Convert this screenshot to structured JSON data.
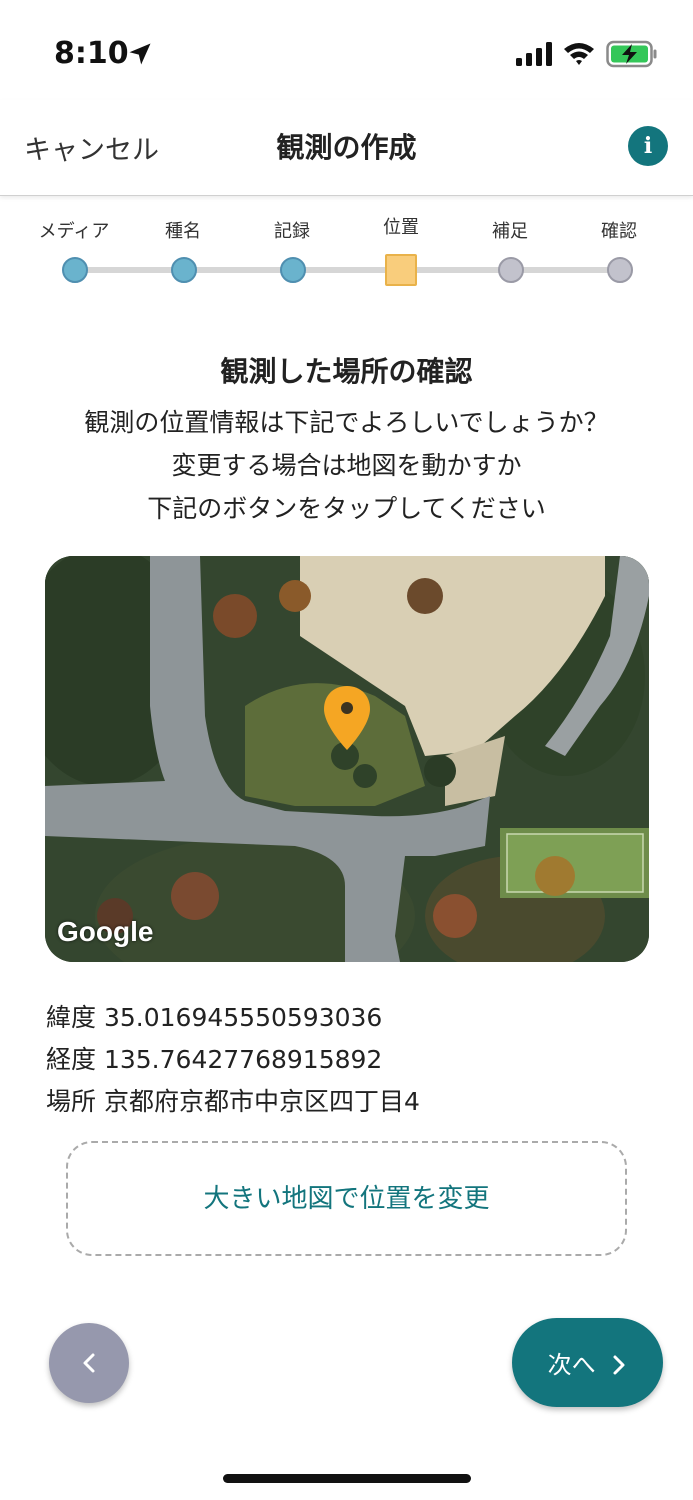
{
  "status_bar": {
    "time": "8:10"
  },
  "nav": {
    "cancel_label": "キャンセル",
    "title": "観測の作成",
    "info_label": "i"
  },
  "stepper": {
    "steps": [
      {
        "label": "メディア",
        "state": "done"
      },
      {
        "label": "種名",
        "state": "done"
      },
      {
        "label": "記録",
        "state": "done"
      },
      {
        "label": "位置",
        "state": "current"
      },
      {
        "label": "補足",
        "state": "todo"
      },
      {
        "label": "確認",
        "state": "todo"
      }
    ]
  },
  "main": {
    "heading": "観測した場所の確認",
    "description_lines": [
      "観測の位置情報は下記でよろしいでしょうか？",
      "変更する場合は地図を動かすか",
      "下記のボタンをタップしてください"
    ],
    "map_attribution": "Google",
    "latitude_label": "緯度",
    "latitude_value": "35.016945550593036",
    "longitude_label": "経度",
    "longitude_value": "135.76427768915892",
    "place_label": "場所",
    "place_value": "京都府京都市中京区四丁目4",
    "change_location_label": "大きい地図で位置を変更"
  },
  "footer": {
    "back_icon": "chevron-left-icon",
    "next_label": "次へ",
    "next_icon": "chevron-right-icon"
  },
  "colors": {
    "accent": "#13757d",
    "step_done": "#6ab3cd",
    "step_current": "#f9cd7c",
    "step_todo": "#c2c2cc",
    "pin": "#f5a623"
  }
}
